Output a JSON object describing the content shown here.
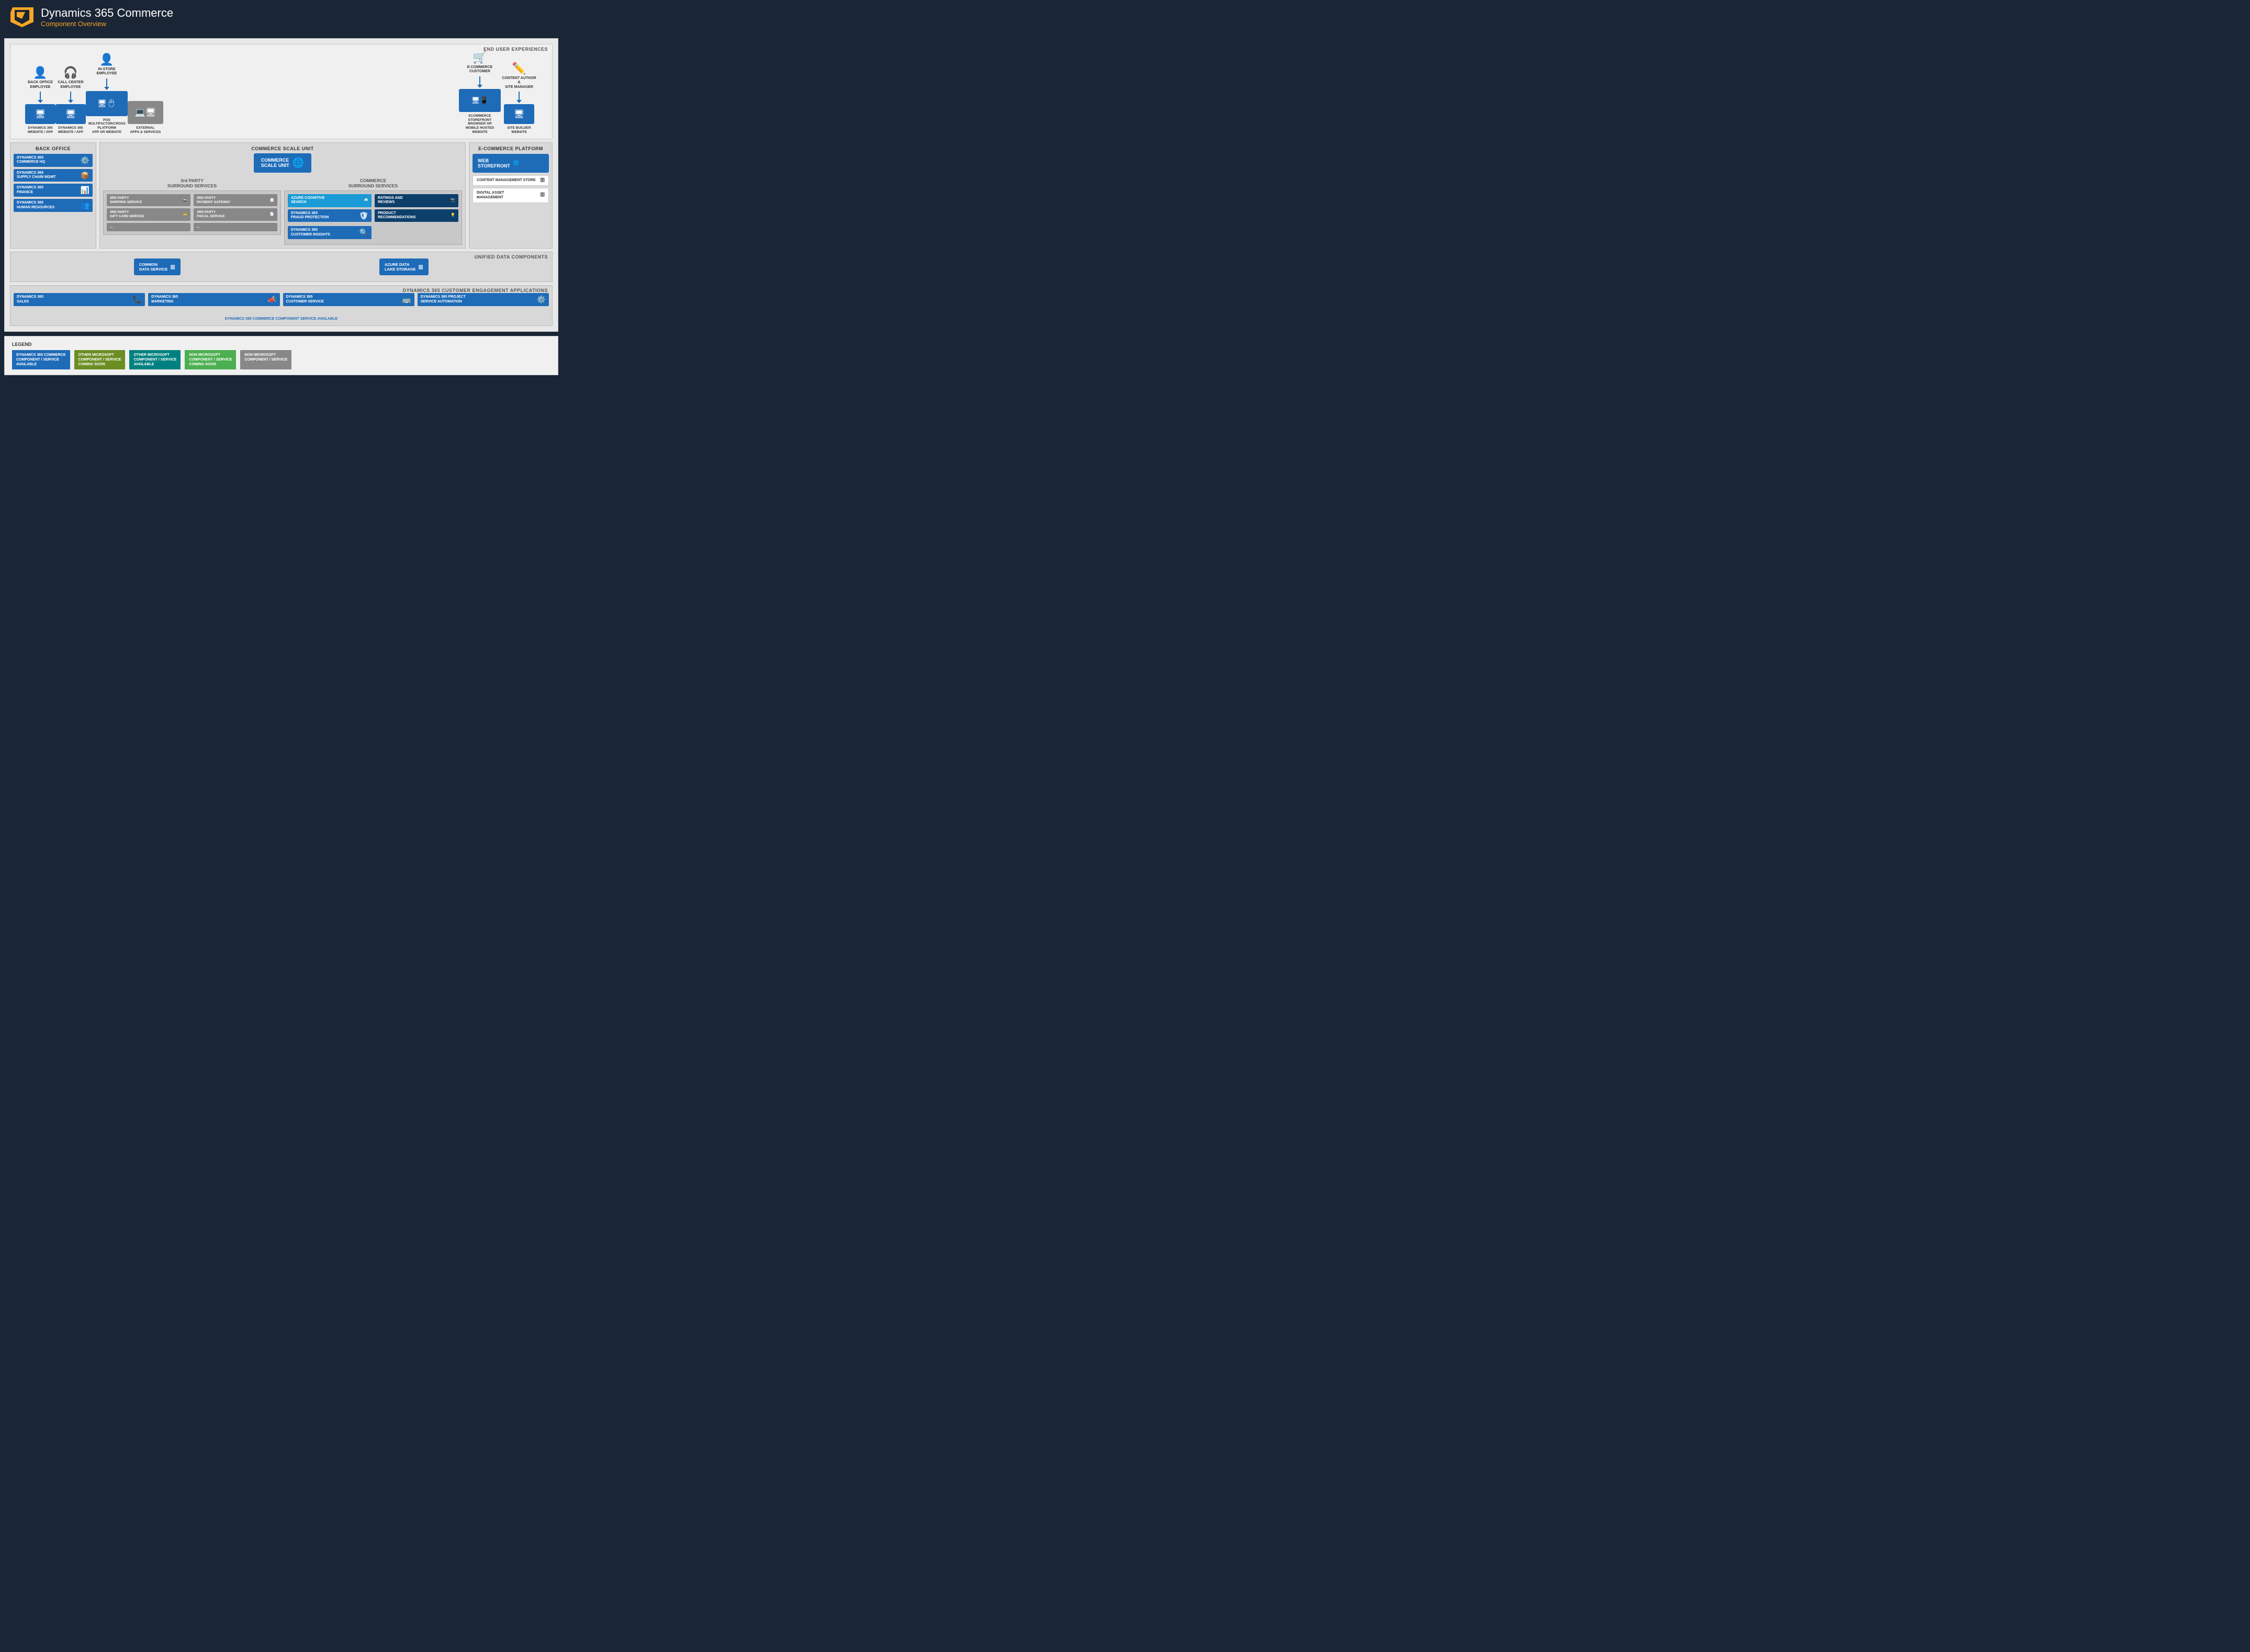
{
  "header": {
    "title": "Dynamics 365 Commerce",
    "subtitle": "Component Overview"
  },
  "endUser": {
    "sectionLabel": "END USER EXPERIENCES",
    "users": [
      {
        "icon": "👤",
        "label": "BACK OFFICE EMPLOYEE",
        "deviceLabel": "DYNAMICS 365\nWEBSITE / APP",
        "deviceIcon": "🖥",
        "color": "blue"
      },
      {
        "icon": "🎧",
        "label": "CALL CENTER EMPLOYEE",
        "deviceLabel": "DYNAMICS 365\nWEBSITE / APP",
        "deviceIcon": "🖥",
        "color": "blue"
      },
      {
        "icon": "👤",
        "label": "IN-STORE EMPLOYEE",
        "deviceLabel": "POS\nMULTIFACTOR/CROSS PLATFORM\nAPP OR WEBSITE",
        "deviceIcon": "🖥",
        "color": "blue"
      },
      {
        "icon": "💻",
        "label": "EXTERNAL\nAPPS & SERVICES",
        "deviceIcon": "💻",
        "color": "gray"
      },
      {
        "icon": "🛒",
        "label": "E-COMMERCE\nCUSTOMER",
        "deviceLabel": "ECOMMERCE STOREFRONT\nBROWSER OR MOBILE HOSTED\nWEBSITE",
        "deviceIcon": "🖥",
        "color": "blue"
      },
      {
        "icon": "✏️",
        "label": "CONTENT AUTHOR &\nSITE MANAGER",
        "deviceLabel": "SITE BUILDER\nWEBSITE",
        "deviceIcon": "🖥",
        "color": "blue"
      }
    ]
  },
  "backOffice": {
    "sectionLabel": "BACK OFFICE",
    "cards": [
      {
        "label": "DYNAMICS 365\nCOMMERCE HQ",
        "icon": "⚙️"
      },
      {
        "label": "DYNAMICS 365\nSUPPLY CHAIN MGMT",
        "icon": "📦"
      },
      {
        "label": "DYNAMICS 365\nFINANCE",
        "icon": "📊"
      },
      {
        "label": "DYNAMICS 365\nHUMAN RESOURCES",
        "icon": "👥"
      }
    ]
  },
  "commerceScaleUnit": {
    "sectionLabel": "COMMERCE SCALE UNIT",
    "centerBoxLabel": "COMMERCE\nSCALE UNIT",
    "centerBoxIcon": "🌐"
  },
  "thirdPartySurround": {
    "sectionLabel": "3rd PARTY\nSURROUND SERVICES",
    "leftCol": [
      {
        "label": "3RD PARTY\nSHIPPING SERVICE",
        "icon": "🚢"
      },
      {
        "label": "3RD PARTY\nGIFT CARD SERVICE",
        "icon": "💳"
      },
      {
        "label": "...",
        "icon": ""
      }
    ],
    "rightCol": [
      {
        "label": "3RD PARTY\nPAYMENT GATEWAY",
        "icon": "🏛"
      },
      {
        "label": "3RD PARTY\nFISCAL SERVICE",
        "icon": "📄"
      },
      {
        "label": "...",
        "icon": ""
      }
    ]
  },
  "commerceSurround": {
    "sectionLabel": "COMMERCE\nSURROUND SERVICES",
    "cards": [
      {
        "label": "AZURE COGNITIVE\nSEARCH",
        "icon": "☁️",
        "color": "azure"
      },
      {
        "label": "DYNAMICS 365\nFRAUD PROTECTION",
        "icon": "🛡",
        "color": "blue"
      },
      {
        "label": "DYNAMICS 365\nCUSTOMER INSIGHTS",
        "icon": "🔍",
        "color": "blue"
      },
      {
        "label": "RATINGS AND\nREVIEWS",
        "icon": "📷",
        "color": "dark"
      },
      {
        "label": "PRODUCT\nRECOMMENDATIONS",
        "icon": "💡",
        "color": "dark"
      }
    ]
  },
  "ecommercePlatform": {
    "sectionLabel": "E-COMMERCE PLATFORM",
    "webStorefrontLabel": "WEB\nSTOREFRONT",
    "webIcon": "🌐",
    "cards": [
      {
        "label": "CONTENT MANAGEMENT STORE",
        "icon": "🗄"
      },
      {
        "label": "DIGITAL ASSET\nMANAGEMENT",
        "icon": "🗄"
      }
    ]
  },
  "unifiedData": {
    "sectionLabel": "UNIFIED DATA COMPONENTS",
    "boxes": [
      {
        "label": "COMMON\nDATA SERVICE",
        "icon": "🗄"
      },
      {
        "label": "AZURE DATA\nLAKE STORAGE",
        "icon": "🗄"
      }
    ]
  },
  "customerEngagement": {
    "sectionLabel": "DYNAMICS 365 CUSTOMER ENGAGEMENT APPLICATIONS",
    "cards": [
      {
        "label": "DYNAMICS 365\nSALES",
        "icon": "📞"
      },
      {
        "label": "DYNAMICS 365\nMARKETING",
        "icon": "📣"
      },
      {
        "label": "DYNAMICS 365\nCUSTOMER SERVICE",
        "icon": "🚌"
      },
      {
        "label": "DYNAMICS 365 PROJECT\nSERVICE AUTOMATION",
        "icon": "⚙️"
      }
    ]
  },
  "legend": {
    "title": "LEGEND",
    "items": [
      {
        "label": "DYNAMICS 365 COMMERCE\nCOMPONENT / SERVICE\nAVAILABLE",
        "colorClass": "legend-blue"
      },
      {
        "label": "OTHER MICROSOFT\nCOMPONENT / SERVICE\nCOMING SOON",
        "colorClass": "legend-olive"
      },
      {
        "label": "OTHER MICROSOFT\nCOMPONENT / SERVICE\nAVAILABLE",
        "colorClass": "legend-teal"
      },
      {
        "label": "NON MICROSOFT\nCOMPONENT / SERVICE\nCOMING SOON",
        "colorClass": "legend-green"
      },
      {
        "label": "NON MICROSOFT\nCOMPONENT / SERVICE",
        "colorClass": "legend-gray"
      }
    ]
  }
}
